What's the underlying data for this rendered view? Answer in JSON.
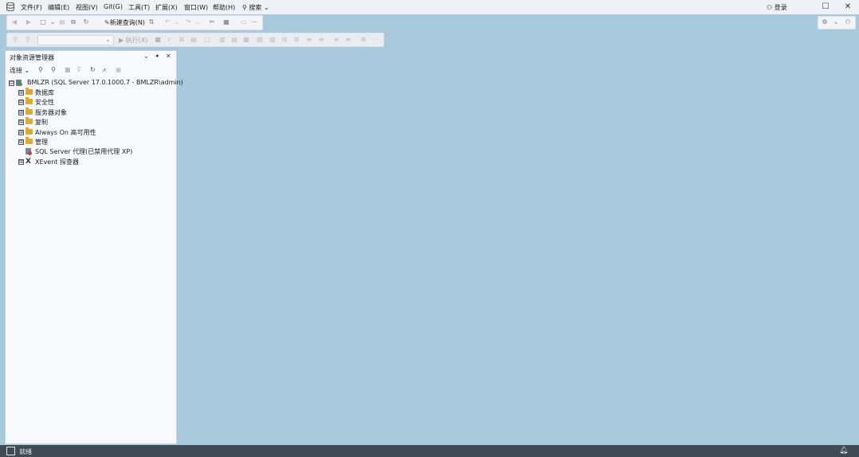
{
  "menubar": {
    "items": [
      "文件(F)",
      "编辑(E)",
      "视图(V)",
      "Git(G)",
      "工具(T)",
      "扩展(X)",
      "窗口(W)",
      "帮助(H)"
    ],
    "search_label": "搜索",
    "login_label": "登录"
  },
  "toolbar": {
    "new_query_label": "新建查询(N)",
    "execute_label": "执行(X)"
  },
  "object_explorer": {
    "title": "对象资源管理器",
    "connect_label": "连接",
    "tree": [
      {
        "label": "BMLZR (SQL Server 17.0.1000.7 - BMLZR\\admin)",
        "expander": "⊟",
        "icon": "server-icon"
      },
      {
        "label": "数据库",
        "expander": "⊞",
        "icon": "folder-icon"
      },
      {
        "label": "安全性",
        "expander": "⊞",
        "icon": "folder-icon"
      },
      {
        "label": "服务器对象",
        "expander": "⊞",
        "icon": "folder-icon"
      },
      {
        "label": "复制",
        "expander": "⊞",
        "icon": "folder-icon"
      },
      {
        "label": "Always On 高可用性",
        "expander": "⊞",
        "icon": "folder-icon"
      },
      {
        "label": "管理",
        "expander": "⊞",
        "icon": "folder-icon"
      },
      {
        "label": "SQL Server 代理(已禁用代理 XP)",
        "expander": "",
        "icon": "agent-icon"
      },
      {
        "label": "XEvent 探查器",
        "expander": "⊞",
        "icon": "xevent-icon"
      }
    ]
  },
  "statusbar": {
    "text": "就绪"
  },
  "colors": {
    "background": "#a8c8dc",
    "statusbar": "#3f4a55",
    "folder": "#d9a93d"
  }
}
